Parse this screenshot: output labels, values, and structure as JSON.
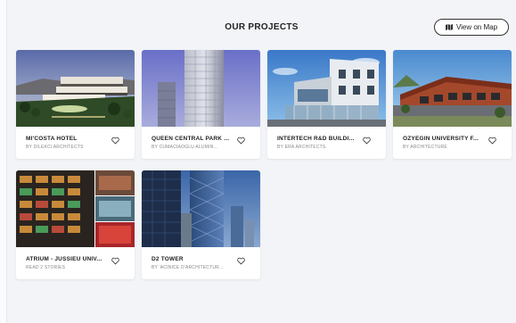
{
  "header": {
    "title": "OUR PROJECTS",
    "map_button_label": "View on Map"
  },
  "projects": [
    {
      "name": "MI'COSTA HOTEL",
      "subtitle": "BY DILEKCI ARCHITECTS"
    },
    {
      "name": "QUEEN CENTRAL PARK ...",
      "subtitle": "BY CUMACIAOGLU ALUMIN..."
    },
    {
      "name": "INTERTECH R&D BUILDI...",
      "subtitle": "BY ERA ARCHITECTS"
    },
    {
      "name": "ÖZYEĞIN UNIVERSITY F...",
      "subtitle": "BY ARCHITECTURE"
    },
    {
      "name": "ATRIUM - JUSSIEU UNIV...",
      "subtitle": "READ 2 STORIES"
    },
    {
      "name": "D2 TOWER",
      "subtitle": "BY 'ACINICE D'ARCHITECTUR..."
    }
  ],
  "icons": {
    "map": "map-icon",
    "favorite": "heart-icon"
  }
}
